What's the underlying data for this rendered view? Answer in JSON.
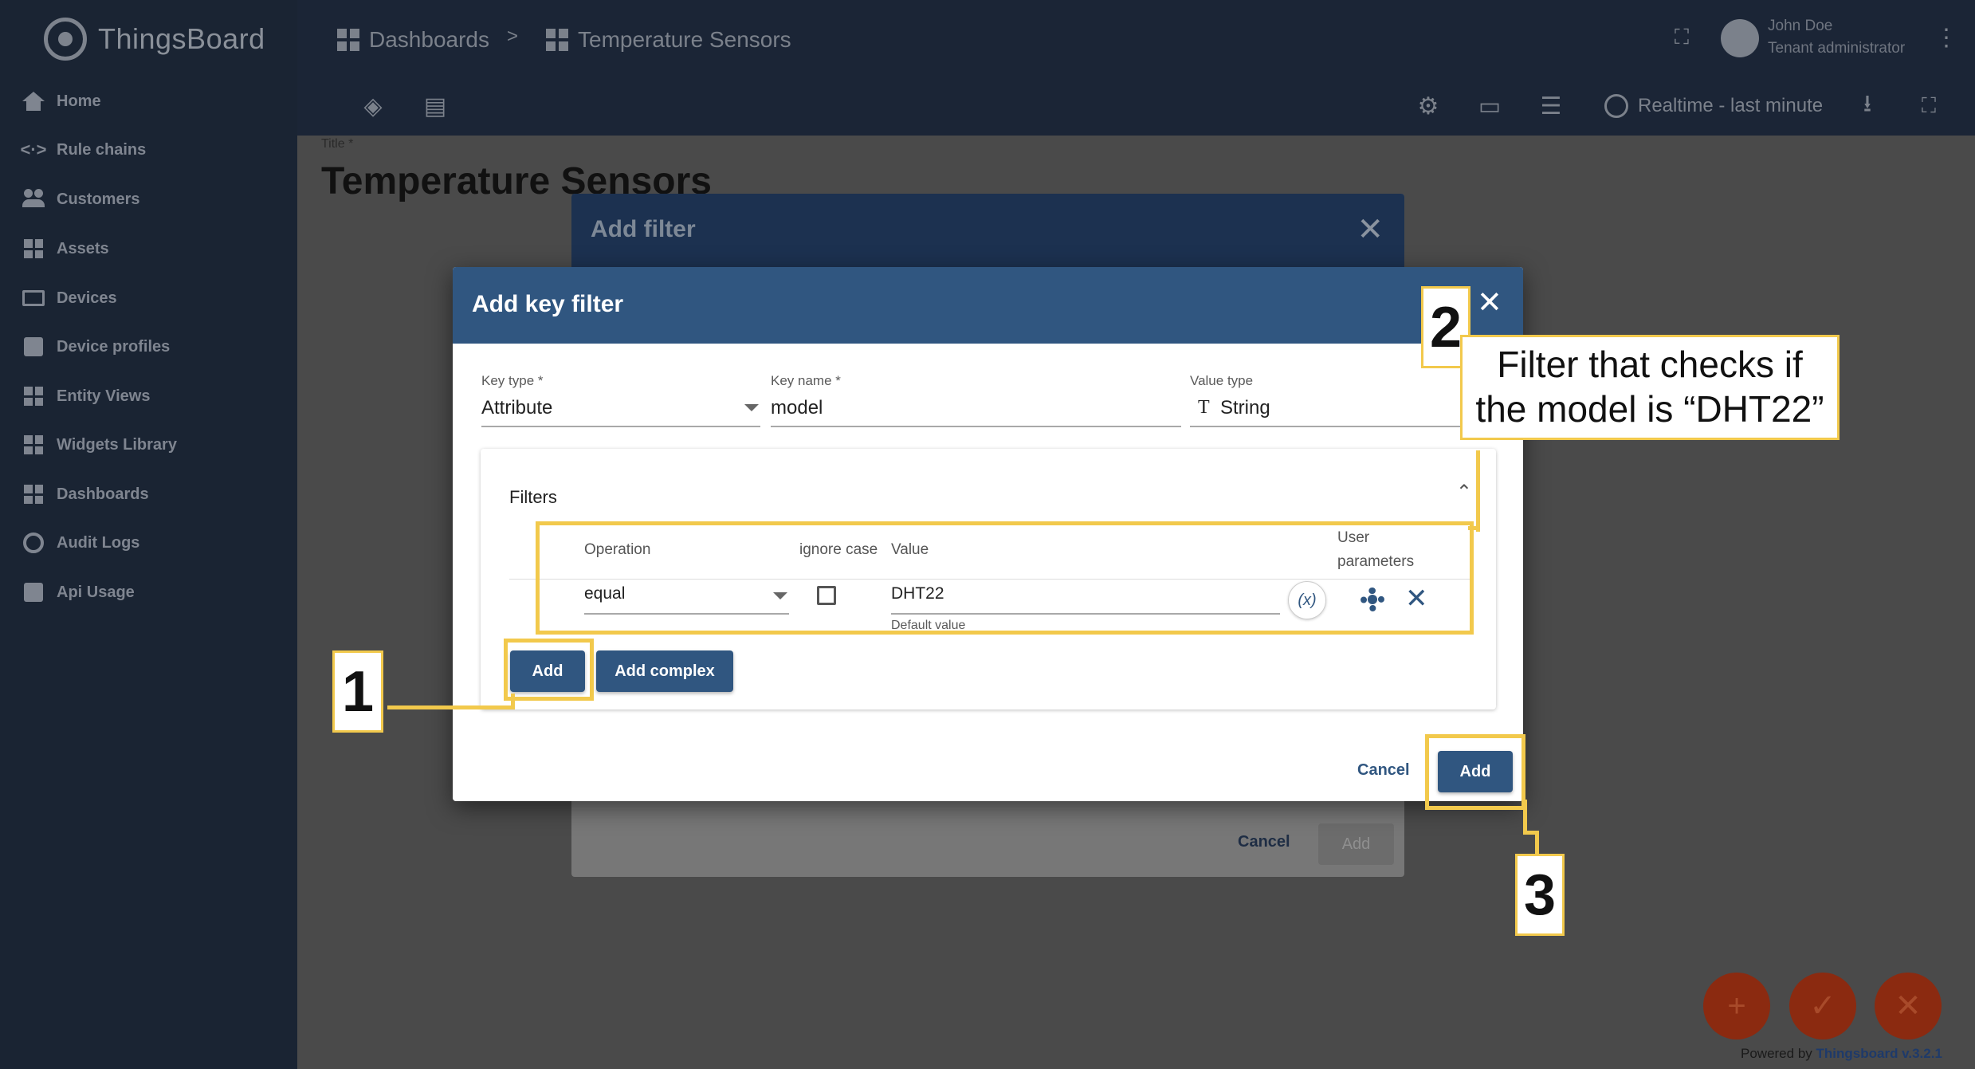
{
  "app": {
    "name": "ThingsBoard"
  },
  "sidebar": {
    "items": [
      {
        "label": "Home",
        "icon": "home-icon"
      },
      {
        "label": "Rule chains",
        "icon": "rule-chains-icon"
      },
      {
        "label": "Customers",
        "icon": "customers-icon"
      },
      {
        "label": "Assets",
        "icon": "assets-icon"
      },
      {
        "label": "Devices",
        "icon": "devices-icon"
      },
      {
        "label": "Device profiles",
        "icon": "device-profiles-icon"
      },
      {
        "label": "Entity Views",
        "icon": "entity-views-icon"
      },
      {
        "label": "Widgets Library",
        "icon": "widgets-library-icon"
      },
      {
        "label": "Dashboards",
        "icon": "dashboards-icon"
      },
      {
        "label": "Audit Logs",
        "icon": "audit-logs-icon"
      },
      {
        "label": "Api Usage",
        "icon": "api-usage-icon"
      }
    ]
  },
  "header": {
    "breadcrumb": [
      "Dashboards",
      "Temperature Sensors"
    ],
    "breadcrumb_sep": ">",
    "user_name": "John Doe",
    "user_role": "Tenant administrator",
    "timewindow": "Realtime - last minute"
  },
  "page": {
    "title_label": "Title *",
    "title": "Temperature Sensors"
  },
  "back_dialog": {
    "title": "Add filter",
    "cancel": "Cancel",
    "add": "Add"
  },
  "dialog": {
    "title": "Add key filter",
    "key_type_label": "Key type *",
    "key_type": "Attribute",
    "key_name_label": "Key name *",
    "key_name": "model",
    "value_type_label": "Value type",
    "value_type_glyph": "T",
    "value_type": "String",
    "filters_title": "Filters",
    "columns": {
      "operation": "Operation",
      "ignore_case": "ignore case",
      "value": "Value",
      "user_params_1": "User",
      "user_params_2": "parameters"
    },
    "row": {
      "operation": "equal",
      "ignore_case": false,
      "value": "DHT22",
      "value_hint": "Default value",
      "param_glyph": "(x)"
    },
    "add_btn": "Add",
    "add_complex_btn": "Add complex",
    "cancel": "Cancel",
    "submit": "Add"
  },
  "annotations": {
    "step1": "1",
    "step2": "2",
    "step3": "3",
    "callout_line1": "Filter that checks if",
    "callout_line2": "the model is “DHT22”",
    "color": "#f2c94c"
  },
  "footer": {
    "powered_prefix": "Powered by",
    "powered_brand": "Thingsboard v.3.2.1"
  }
}
